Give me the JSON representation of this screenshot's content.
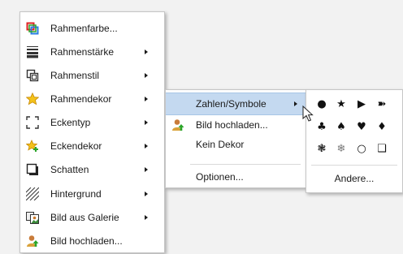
{
  "menu_main": {
    "items": [
      {
        "label": "Rahmenfarbe...",
        "icon": "frame-color-icon",
        "submenu": false
      },
      {
        "label": "Rahmenstärke",
        "icon": "frame-thickness-icon",
        "submenu": true
      },
      {
        "label": "Rahmenstil",
        "icon": "frame-style-icon",
        "submenu": true
      },
      {
        "label": "Rahmendekor",
        "icon": "star-icon",
        "submenu": true
      },
      {
        "label": "Eckentyp",
        "icon": "corner-type-icon",
        "submenu": true
      },
      {
        "label": "Eckendekor",
        "icon": "star-plus-icon",
        "submenu": true
      },
      {
        "label": "Schatten",
        "icon": "shadow-icon",
        "submenu": true
      },
      {
        "label": "Hintergrund",
        "icon": "hatch-pattern-icon",
        "submenu": true
      },
      {
        "label": "Bild aus Galerie",
        "icon": "gallery-image-icon",
        "submenu": true
      },
      {
        "label": "Bild hochladen...",
        "icon": "upload-person-icon",
        "submenu": false
      }
    ]
  },
  "menu_dekor": {
    "items": [
      {
        "label": "Zahlen/Symbole",
        "submenu": true,
        "highlighted": true
      },
      {
        "label": "Bild hochladen...",
        "icon": "upload-person-icon",
        "submenu": false
      },
      {
        "label": "Kein Dekor",
        "submenu": false
      }
    ],
    "options_label": "Optionen..."
  },
  "menu_symbols": {
    "rows": [
      [
        "●",
        "★",
        "▶",
        "➽"
      ],
      [
        "♣",
        "♠",
        "♥",
        "♦"
      ],
      [
        "❃",
        "❄",
        "○",
        "❑"
      ]
    ],
    "more_label": "Andere..."
  },
  "colors": {
    "highlight": "#c4d9f0",
    "menu_bg": "#ffffff",
    "page_bg": "#f2f2f2"
  }
}
